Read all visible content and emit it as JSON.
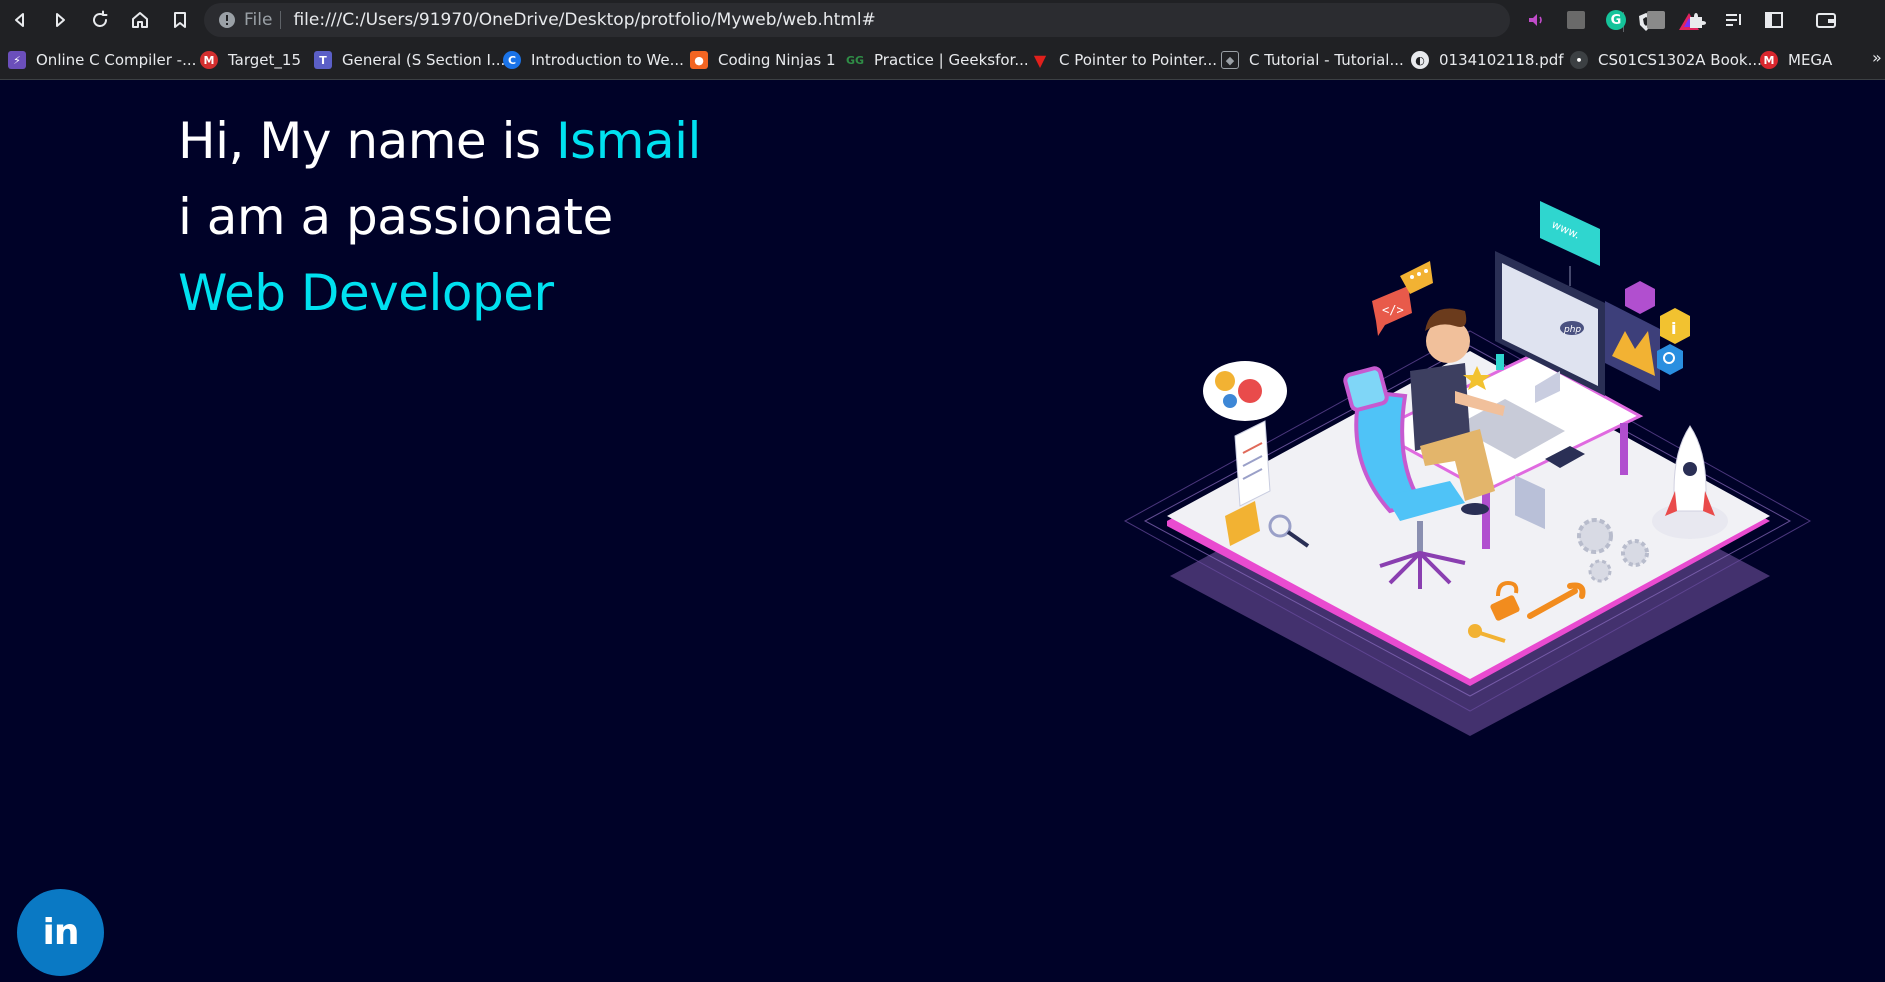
{
  "browser": {
    "url_scheme": "File",
    "url": "file:///C:/Users/91970/OneDrive/Desktop/protfolio/Myweb/web.html#",
    "bookmarks": [
      {
        "label": "Online C Compiler -...",
        "color": "#6b4fbb"
      },
      {
        "label": "Target_15",
        "color": "#d32f2f"
      },
      {
        "label": "General (S Section I...",
        "color": "#5b5fc7"
      },
      {
        "label": "Introduction to We...",
        "color": "#1a73e8"
      },
      {
        "label": "Coding Ninjas 1",
        "color": "#f26522"
      },
      {
        "label": "Practice | Geeksfor...",
        "color": "#2f8d46"
      },
      {
        "label": "C Pointer to Pointer...",
        "color": "#e0201c"
      },
      {
        "label": "C Tutorial - Tutorial...",
        "color": "#9aa0a6"
      },
      {
        "label": "0134102118.pdf",
        "color": "#e8eaed"
      },
      {
        "label": "CS01CS1302A Book...",
        "color": "#3c4043"
      },
      {
        "label": "MEGA",
        "color": "#d9272e"
      }
    ],
    "more_label": "»"
  },
  "hero": {
    "greeting": "Hi, My name is ",
    "name": "Ismail",
    "line2": "i am a passionate",
    "role": "Web Developer"
  },
  "social": {
    "linkedin_label": "in"
  },
  "colors": {
    "background": "#000228",
    "accent": "#00e1f0",
    "linkedin": "#0a79c4"
  }
}
